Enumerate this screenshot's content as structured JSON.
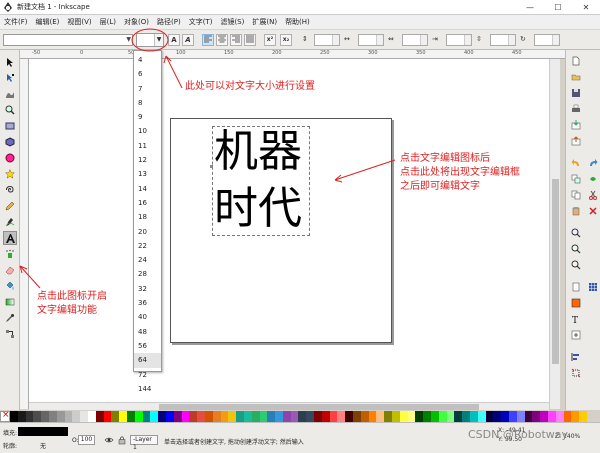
{
  "window": {
    "title": "新建文档 1 - Inkscape",
    "controls": [
      "—",
      "☐",
      "✕"
    ]
  },
  "menubar": {
    "items": [
      "文件(F)",
      "编辑(E)",
      "视图(V)",
      "层(L)",
      "对象(O)",
      "路径(P)",
      "文字(T)",
      "滤镜(S)",
      "扩展(N)",
      "帮助(H)"
    ]
  },
  "textbar": {
    "bold_label": "A",
    "italic_label": "A",
    "superscript_label": "x²",
    "subscript_label": "x₂"
  },
  "ruler": {
    "ticks": [
      "-50",
      "0",
      "50",
      "100",
      "150",
      "200",
      "250",
      "300",
      "350",
      "400",
      "450"
    ]
  },
  "font_size_dropdown": {
    "options": [
      "4",
      "6",
      "7",
      "8",
      "9",
      "10",
      "11",
      "12",
      "13",
      "14",
      "16",
      "18",
      "20",
      "22",
      "24",
      "28",
      "32",
      "36",
      "40",
      "48",
      "56",
      "64",
      "72",
      "144"
    ],
    "selected": "64"
  },
  "canvas": {
    "text_lines": [
      "机器",
      "时代"
    ]
  },
  "annotations": {
    "font_size": "此处可以对文字大小进行设置",
    "text_tool_line1": "点击此图标开启",
    "text_tool_line2": "文字编辑功能",
    "canvas_line1": "点击文字编辑图标后",
    "canvas_line2": "点击此处将出现文字编辑框",
    "canvas_line3": "之后即可编辑文字"
  },
  "palette": {
    "colors": [
      "#000000",
      "#1a1a1a",
      "#333333",
      "#4d4d4d",
      "#666666",
      "#808080",
      "#999999",
      "#b3b3b3",
      "#cccccc",
      "#e6e6e6",
      "#ffffff",
      "#800000",
      "#ff0000",
      "#808000",
      "#ffff00",
      "#008000",
      "#00ff00",
      "#008080",
      "#00ffff",
      "#000080",
      "#0000ff",
      "#800080",
      "#ff00ff",
      "#c0392b",
      "#e74c3c",
      "#d35400",
      "#e67e22",
      "#f39c12",
      "#f1c40f",
      "#16a085",
      "#1abc9c",
      "#27ae60",
      "#2ecc71",
      "#2980b9",
      "#3498db",
      "#8e44ad",
      "#9b59b6",
      "#2c3e50",
      "#34495e",
      "#7f0000",
      "#bf0000",
      "#ff4040",
      "#ff8080",
      "#400000",
      "#7f3f00",
      "#bf5f00",
      "#ff7f00",
      "#ffbf7f",
      "#7f7f00",
      "#bfbf00",
      "#ffff40",
      "#ffff80",
      "#003f00",
      "#007f00",
      "#00bf00",
      "#40ff40",
      "#80ff80",
      "#003f3f",
      "#007f7f",
      "#00bfbf",
      "#40ffff",
      "#00003f",
      "#00007f",
      "#0000bf",
      "#4040ff",
      "#8080ff",
      "#3f003f",
      "#7f007f",
      "#bf00bf",
      "#ff40ff",
      "#ff80ff",
      "#ff6600",
      "#ff9900",
      "#ffcc00"
    ]
  },
  "statusbar": {
    "fill_label": "填充:",
    "stroke_label": "轮廓:",
    "stroke_value": "无",
    "opacity_label": "O:",
    "opacity_value": "100",
    "layer": "-Layer 1",
    "message": "单击选择或者创建文字, 拖动创建浮动文字; 然后输入",
    "x_label": "X:",
    "x_value": "-49.41",
    "y_label": "Y:",
    "y_value": "99.50",
    "zoom_label": "Z:",
    "zoom_value": "140%"
  },
  "watermark": "CSDN @Robotway",
  "colors": {
    "annotation": "#e02020"
  }
}
